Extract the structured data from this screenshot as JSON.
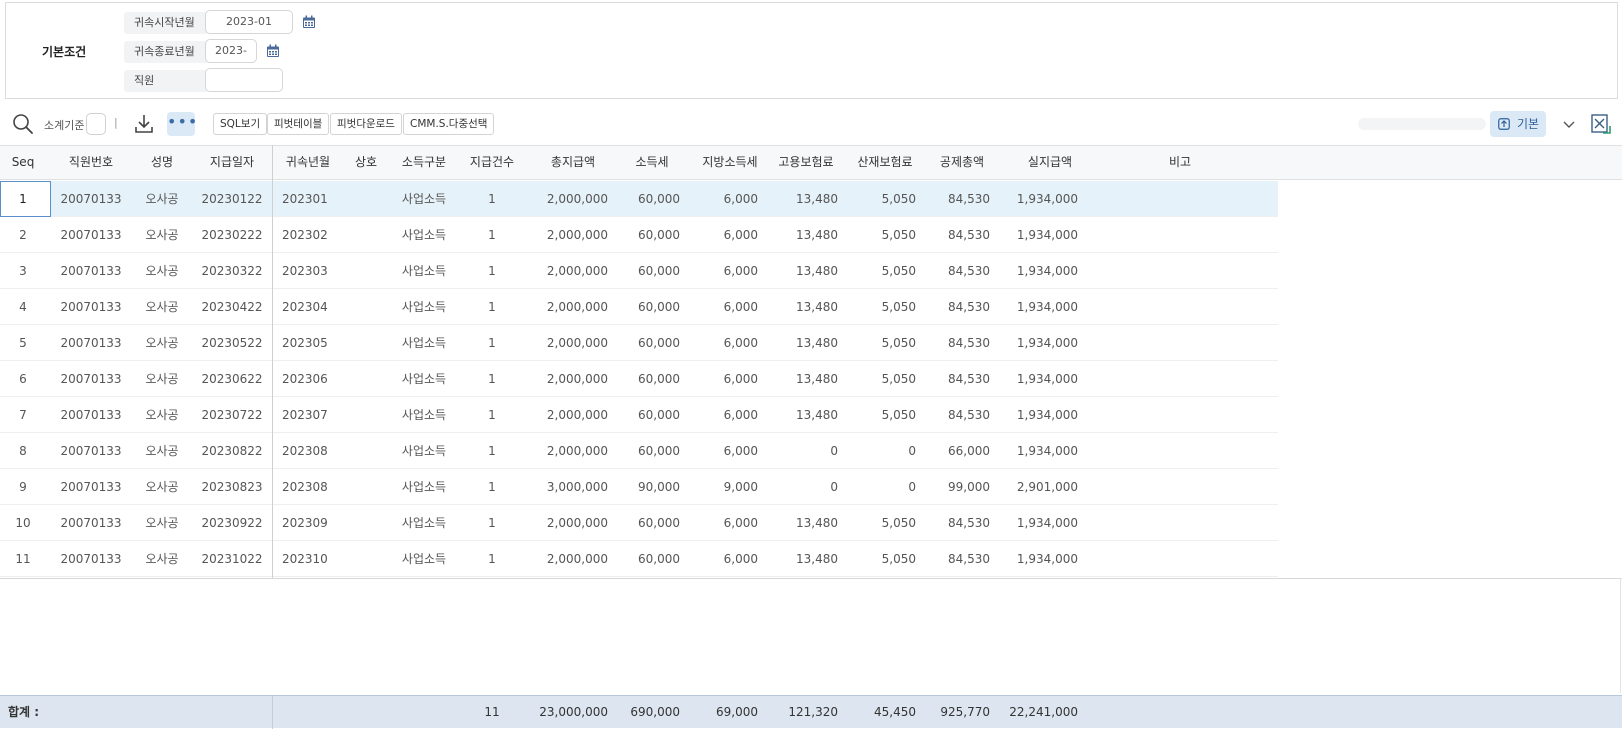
{
  "conditions": {
    "title": "기본조건",
    "start_label": "귀속시작년월",
    "start_value": "2023-01",
    "end_label": "귀속종료년월",
    "end_value": "2023-",
    "employee_label": "직원",
    "employee_value": ""
  },
  "toolbar": {
    "subtotal_label": "소계기준",
    "separator": "|",
    "more": "•••",
    "buttons": [
      "SQL보기",
      "피벗테이블",
      "피벗다운로드",
      "CMM.S.다중선택"
    ],
    "view_label": "기본"
  },
  "grid": {
    "columns": [
      "Seq",
      "직원번호",
      "성명",
      "지급일자",
      "귀속년월",
      "상호",
      "소득구분",
      "지급건수",
      "총지급액",
      "소득세",
      "지방소득세",
      "고용보험료",
      "산재보험료",
      "공제총액",
      "실지급액",
      "비고"
    ],
    "rows": [
      [
        "1",
        "20070133",
        "오사공",
        "20230122",
        "202301",
        "",
        "사업소득",
        "1",
        "2,000,000",
        "60,000",
        "6,000",
        "13,480",
        "5,050",
        "84,530",
        "1,934,000",
        ""
      ],
      [
        "2",
        "20070133",
        "오사공",
        "20230222",
        "202302",
        "",
        "사업소득",
        "1",
        "2,000,000",
        "60,000",
        "6,000",
        "13,480",
        "5,050",
        "84,530",
        "1,934,000",
        ""
      ],
      [
        "3",
        "20070133",
        "오사공",
        "20230322",
        "202303",
        "",
        "사업소득",
        "1",
        "2,000,000",
        "60,000",
        "6,000",
        "13,480",
        "5,050",
        "84,530",
        "1,934,000",
        ""
      ],
      [
        "4",
        "20070133",
        "오사공",
        "20230422",
        "202304",
        "",
        "사업소득",
        "1",
        "2,000,000",
        "60,000",
        "6,000",
        "13,480",
        "5,050",
        "84,530",
        "1,934,000",
        ""
      ],
      [
        "5",
        "20070133",
        "오사공",
        "20230522",
        "202305",
        "",
        "사업소득",
        "1",
        "2,000,000",
        "60,000",
        "6,000",
        "13,480",
        "5,050",
        "84,530",
        "1,934,000",
        ""
      ],
      [
        "6",
        "20070133",
        "오사공",
        "20230622",
        "202306",
        "",
        "사업소득",
        "1",
        "2,000,000",
        "60,000",
        "6,000",
        "13,480",
        "5,050",
        "84,530",
        "1,934,000",
        ""
      ],
      [
        "7",
        "20070133",
        "오사공",
        "20230722",
        "202307",
        "",
        "사업소득",
        "1",
        "2,000,000",
        "60,000",
        "6,000",
        "13,480",
        "5,050",
        "84,530",
        "1,934,000",
        ""
      ],
      [
        "8",
        "20070133",
        "오사공",
        "20230822",
        "202308",
        "",
        "사업소득",
        "1",
        "2,000,000",
        "60,000",
        "6,000",
        "0",
        "0",
        "66,000",
        "1,934,000",
        ""
      ],
      [
        "9",
        "20070133",
        "오사공",
        "20230823",
        "202308",
        "",
        "사업소득",
        "1",
        "3,000,000",
        "90,000",
        "9,000",
        "0",
        "0",
        "99,000",
        "2,901,000",
        ""
      ],
      [
        "10",
        "20070133",
        "오사공",
        "20230922",
        "202309",
        "",
        "사업소득",
        "1",
        "2,000,000",
        "60,000",
        "6,000",
        "13,480",
        "5,050",
        "84,530",
        "1,934,000",
        ""
      ],
      [
        "11",
        "20070133",
        "오사공",
        "20231022",
        "202310",
        "",
        "사업소득",
        "1",
        "2,000,000",
        "60,000",
        "6,000",
        "13,480",
        "5,050",
        "84,530",
        "1,934,000",
        ""
      ]
    ],
    "footer": {
      "label": "합계 :",
      "count": "11",
      "total_pay": "23,000,000",
      "income_tax": "690,000",
      "local_tax": "69,000",
      "employment_ins": "121,320",
      "accident_ins": "45,450",
      "total_deduction": "925,770",
      "net_pay": "22,241,000"
    }
  },
  "colors": {
    "selected_row": "#e6f2f9",
    "footer_bg": "#dde6f0",
    "accent_button_bg": "#dbe9f7",
    "selection_border": "#5b8fc9"
  },
  "icons": {
    "search": "search-icon",
    "download": "download-icon",
    "calendar": "calendar-icon",
    "view": "view-select-icon",
    "chevron": "chevron-down-icon",
    "excel": "excel-export-icon"
  }
}
